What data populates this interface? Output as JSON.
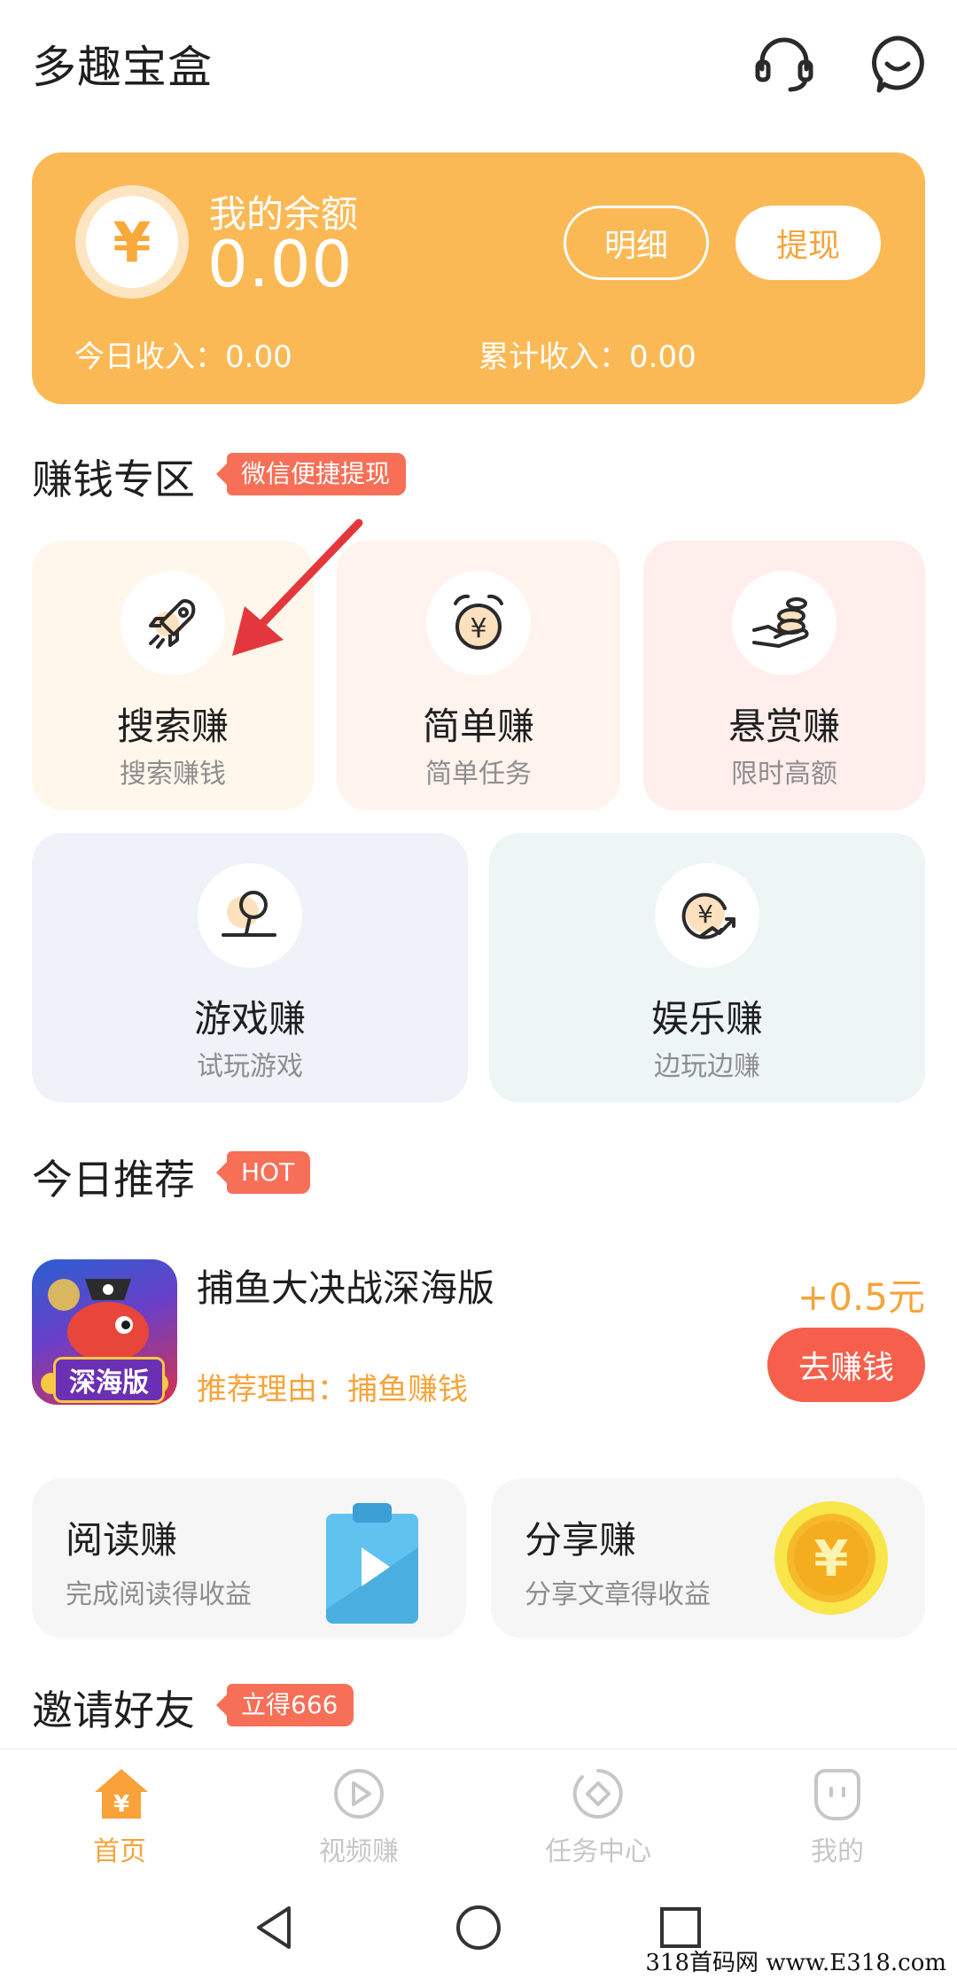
{
  "app": {
    "title": "多趣宝盒"
  },
  "top_icons": {
    "service": "headset-icon",
    "message": "smile-chat-icon"
  },
  "balance": {
    "label": "我的余额",
    "amount": "0.00",
    "currency_symbol": "¥",
    "detail_button": "明细",
    "withdraw_button": "提现",
    "today_income_label": "今日收入：",
    "today_income_value": "0.00",
    "total_income_label": "累计收入：",
    "total_income_value": "0.00"
  },
  "earn_section": {
    "title": "赚钱专区",
    "tag": "微信便捷提现",
    "cards": [
      {
        "title": "搜索赚",
        "subtitle": "搜索赚钱",
        "icon": "rocket-icon"
      },
      {
        "title": "简单赚",
        "subtitle": "简单任务",
        "icon": "alarm-coin-icon"
      },
      {
        "title": "悬赏赚",
        "subtitle": "限时高额",
        "icon": "hand-coins-icon"
      },
      {
        "title": "游戏赚",
        "subtitle": "试玩游戏",
        "icon": "joystick-icon"
      },
      {
        "title": "娱乐赚",
        "subtitle": "边玩边赚",
        "icon": "coin-trend-icon"
      }
    ]
  },
  "recommend": {
    "title": "今日推荐",
    "tag": "HOT",
    "item": {
      "name": "捕鱼大决战深海版",
      "reason_label": "推荐理由：",
      "reason": "捕鱼赚钱",
      "reward": "+0.5元",
      "button": "去赚钱",
      "thumb_text": "深海版"
    }
  },
  "mini_cards": [
    {
      "title": "阅读赚",
      "subtitle": "完成阅读得收益",
      "icon": "clipboard-play-icon"
    },
    {
      "title": "分享赚",
      "subtitle": "分享文章得收益",
      "icon": "gold-coin-icon"
    }
  ],
  "invite": {
    "title": "邀请好友",
    "tag": "立得666"
  },
  "bottom_nav": [
    {
      "label": "首页",
      "active": true
    },
    {
      "label": "视频赚",
      "active": false
    },
    {
      "label": "任务中心",
      "active": false
    },
    {
      "label": "我的",
      "active": false
    }
  ],
  "watermark": "318首码网 www.E318.com",
  "colors": {
    "accent_orange": "#fbb955",
    "primary_red": "#f55f4b",
    "text_orange": "#f5a43a",
    "inactive_gray": "#c7c7c7"
  }
}
